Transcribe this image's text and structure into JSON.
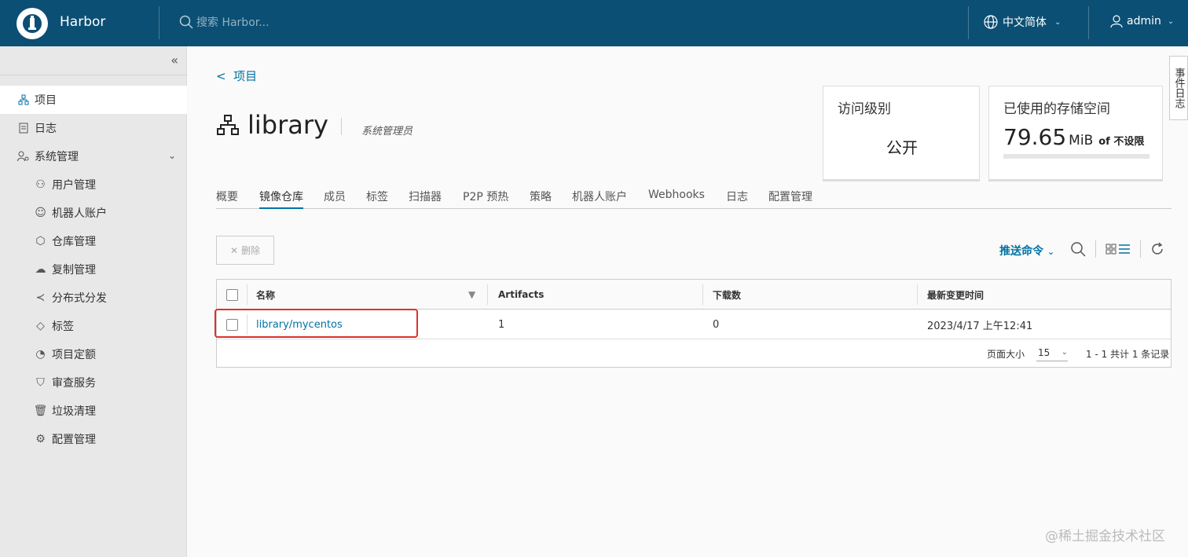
{
  "header": {
    "app_name": "Harbor",
    "search_placeholder": "搜索 Harbor...",
    "language": "中文简体",
    "user": "admin"
  },
  "sidebar": {
    "items": [
      {
        "label": "项目",
        "icon": "project-icon"
      },
      {
        "label": "日志",
        "icon": "log-icon"
      },
      {
        "label": "系统管理",
        "icon": "system-admin-icon"
      }
    ],
    "sub_items": [
      {
        "label": "用户管理",
        "icon": "users-icon"
      },
      {
        "label": "机器人账户",
        "icon": "robot-icon"
      },
      {
        "label": "仓库管理",
        "icon": "cube-icon"
      },
      {
        "label": "复制管理",
        "icon": "cloud-icon"
      },
      {
        "label": "分布式分发",
        "icon": "share-icon"
      },
      {
        "label": "标签",
        "icon": "tag-icon"
      },
      {
        "label": "项目定额",
        "icon": "quota-icon"
      },
      {
        "label": "审查服务",
        "icon": "shield-icon"
      },
      {
        "label": "垃圾清理",
        "icon": "trash-icon"
      },
      {
        "label": "配置管理",
        "icon": "gear-icon"
      }
    ]
  },
  "main": {
    "back_label": "项目",
    "project_name": "library",
    "role": "系统管理员",
    "access_card": {
      "title": "访问级别",
      "value": "公开"
    },
    "storage_card": {
      "title": "已使用的存储空间",
      "value": "79.65",
      "unit": "MiB",
      "of": "of 不设限"
    },
    "side_tab": "事件日志",
    "tabs": [
      "概要",
      "镜像仓库",
      "成员",
      "标签",
      "扫描器",
      "P2P 预热",
      "策略",
      "机器人账户",
      "Webhooks",
      "日志",
      "配置管理"
    ],
    "active_tab": "镜像仓库",
    "delete_label": "删除",
    "push_command": "推送命令",
    "table": {
      "columns": [
        "名称",
        "Artifacts",
        "下载数",
        "最新变更时间"
      ],
      "rows": [
        {
          "name": "library/mycentos",
          "artifacts": "1",
          "downloads": "0",
          "updated": "2023/4/17 上午12:41"
        }
      ],
      "page_size_label": "页面大小",
      "page_size": "15",
      "count_text": "1 - 1 共计 1 条记录"
    }
  },
  "watermark": "@稀土掘金技术社区",
  "colors": {
    "header": "#0b4f74",
    "accent": "#0072a3",
    "highlight": "#e0302a"
  }
}
